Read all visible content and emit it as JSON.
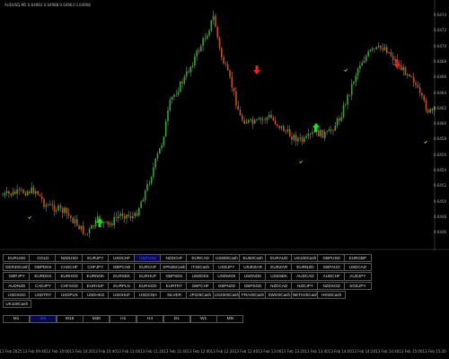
{
  "chart": {
    "header": "AUDUSD,M5 0.64983 0.64988 0.64963 0.64968",
    "price_ticks": [
      "0.6474",
      "0.6472",
      "0.6470",
      "0.6468",
      "0.6466",
      "0.6464",
      "0.6462",
      "0.6460",
      "0.6458",
      "0.6456",
      "0.6454",
      "0.6452",
      "0.6450",
      "0.6448",
      "0.6446"
    ],
    "time_ticks": [
      "13 Feb 2025",
      "13 Feb 09:40",
      "13 Feb 10:00",
      "13 Feb 10:20",
      "13 Feb 10:40",
      "13 Feb 11:00",
      "13 Feb 11:20",
      "13 Feb 11:40",
      "13 Feb 12:00",
      "13 Feb 12:20",
      "13 Feb 12:40",
      "13 Feb 13:00",
      "13 Feb 13:20",
      "13 Feb 13:40",
      "13 Feb 14:00",
      "13 Feb 14:20",
      "13 Feb 14:40",
      "13 Feb 15:00",
      "13 Feb 15:20"
    ],
    "colors": {
      "bull": "#2fa82f",
      "bear": "#d24a1a",
      "wick": "#c8c8c8",
      "buy_arrow": "#22dd22",
      "sell_arrow": "#ee2222",
      "marker": "#e8e000"
    },
    "icons": [
      "buy-arrow-icon",
      "sell-arrow-icon",
      "marker-tick-icon"
    ]
  },
  "symbols": [
    [
      "EURUSD",
      "GOLD",
      "NZDUSD",
      "EURJPY",
      "USDCHF",
      "GBPUSD",
      "NZDCHF",
      "EURCAD",
      "US500Cash",
      "EU50Cash",
      "EURAUD",
      "US100Cash",
      "GBPUSD",
      "EURGBP"
    ],
    [
      "GER40Cash",
      "GBPDKK",
      "CADCHF",
      "CHFJPY",
      "GBPCAD",
      "EURCHF",
      "SPN35Cash",
      "IT40Cash",
      "USDJPY",
      "US30ZAR",
      "EURZAR",
      "EURNZD",
      "GBPAUD",
      "USDCAD"
    ],
    [
      "GBPJPY",
      "EURDKK",
      "EURHKD",
      "EURNOK",
      "EURSEK",
      "EURHUF",
      "GBPSEK",
      "USDDKK",
      "USDMXN",
      "USDNOK",
      "USDSEK",
      "AUDCAD",
      "AUDCHF",
      "AUDJPY"
    ],
    [
      "AUDNZD",
      "CADJPY",
      "CHFSGD",
      "EURHUF",
      "EURPLN",
      "EURSGD",
      "EURTRY",
      "GBPCHF",
      "GBPNZD",
      "GBPSGD",
      "NZDCAD",
      "NZDJPY",
      "NZDSGD",
      "SGDJPY"
    ],
    [
      "USDSGD",
      "USDTRY",
      "USDPLN",
      "USDHKD",
      "USDHUF",
      "USDCNH",
      "SILVER",
      "JP225Cash",
      "US2000Cash",
      "FRA40Cash",
      "SWI20Cash",
      "NETH25Cash",
      "HK50Cash"
    ],
    [
      "UK100Cash"
    ]
  ],
  "active_symbol": "GBPUSD",
  "timeframes": [
    "M1",
    "M5",
    "M15",
    "M30",
    "H1",
    "H4",
    "D1",
    "W1",
    "MN"
  ],
  "active_timeframe": "M5"
}
